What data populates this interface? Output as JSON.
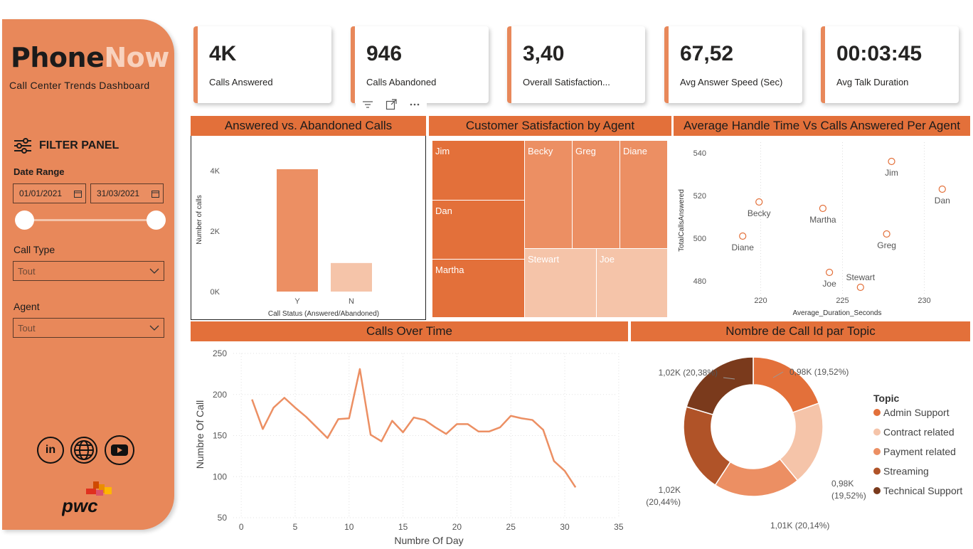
{
  "sidebar": {
    "brand_part1": "Phone",
    "brand_part2": "Now",
    "subtitle": "Call Center Trends Dashboard",
    "filter_title": "FILTER PANEL",
    "date_range_label": "Date Range",
    "date_start": "01/01/2021",
    "date_end": "31/03/2021",
    "call_type_label": "Call Type",
    "call_type_value": "Tout",
    "agent_label": "Agent",
    "agent_value": "Tout",
    "social_linkedin": "in",
    "pwc_text": "pwc"
  },
  "kpis": [
    {
      "value": "4K",
      "caption": "Calls Answered"
    },
    {
      "value": "946",
      "caption": "Calls Abandoned"
    },
    {
      "value": "3,40",
      "caption": "Overall Satisfaction..."
    },
    {
      "value": "67,52",
      "caption": "Avg Answer Speed (Sec)"
    },
    {
      "value": "00:03:45",
      "caption": "Avg Talk Duration"
    }
  ],
  "colors": {
    "accent": "#E3703A",
    "sidebar": "#E8885A",
    "bar_y": "#EC8F63",
    "bar_n": "#F5C4A9",
    "line": "#EC8F63",
    "treemap_dark": "#E3703A",
    "treemap_mid": "#EC8F63",
    "treemap_light": "#F5C4A9"
  },
  "charts": {
    "bar": {
      "title": "Answered vs. Abandoned Calls",
      "xlabel": "Call Status (Answered/Abandoned)",
      "ylabel": "Number of calls"
    },
    "treemap": {
      "title": "Customer Satisfaction by Agent"
    },
    "scatter": {
      "title": "Average Handle Time Vs Calls Answered Per Agent",
      "xlabel": "Average_Duration_Seconds",
      "ylabel": "TotalCallsAnswered"
    },
    "line": {
      "title": "Calls Over Time",
      "xlabel": "Numbre Of Day",
      "ylabel": "Numbre Of Call"
    },
    "donut": {
      "title": "Nombre de Call Id par Topic",
      "legend_title": "Topic"
    }
  },
  "chart_data": [
    {
      "type": "bar",
      "categories": [
        "Y",
        "N"
      ],
      "values": [
        4054,
        946
      ],
      "ylim": [
        0,
        4500
      ],
      "yticks": [
        "0K",
        "2K",
        "4K"
      ],
      "ytick_values": [
        0,
        2000,
        4000
      ]
    },
    {
      "type": "treemap",
      "items": [
        {
          "name": "Jim",
          "shade": "dark"
        },
        {
          "name": "Dan",
          "shade": "dark"
        },
        {
          "name": "Martha",
          "shade": "dark"
        },
        {
          "name": "Becky",
          "shade": "mid"
        },
        {
          "name": "Greg",
          "shade": "mid"
        },
        {
          "name": "Diane",
          "shade": "mid"
        },
        {
          "name": "Stewart",
          "shade": "light"
        },
        {
          "name": "Joe",
          "shade": "light"
        }
      ]
    },
    {
      "type": "scatter",
      "xlim": [
        217.5,
        232.5
      ],
      "ylim": [
        470,
        545
      ],
      "xticks": [
        220,
        225,
        230
      ],
      "yticks": [
        480,
        500,
        520,
        540
      ],
      "points": [
        {
          "label": "Jim",
          "x": 228.0,
          "y": 536
        },
        {
          "label": "Dan",
          "x": 231.1,
          "y": 523
        },
        {
          "label": "Becky",
          "x": 219.9,
          "y": 517
        },
        {
          "label": "Martha",
          "x": 223.8,
          "y": 514
        },
        {
          "label": "Greg",
          "x": 227.7,
          "y": 502
        },
        {
          "label": "Diane",
          "x": 218.9,
          "y": 501
        },
        {
          "label": "Stewart",
          "x": 226.1,
          "y": 477
        },
        {
          "label": "Joe",
          "x": 224.2,
          "y": 484
        }
      ]
    },
    {
      "type": "line",
      "xlim": [
        -1,
        36
      ],
      "ylim": [
        50,
        250
      ],
      "xticks": [
        0,
        5,
        10,
        15,
        20,
        25,
        30,
        35
      ],
      "yticks": [
        50,
        100,
        150,
        200,
        250
      ],
      "x": [
        1,
        2,
        3,
        4,
        5,
        6,
        7,
        8,
        9,
        10,
        11,
        12,
        13,
        14,
        15,
        16,
        17,
        18,
        19,
        20,
        21,
        22,
        23,
        24,
        25,
        26,
        27,
        28,
        29,
        30,
        31
      ],
      "y": [
        194,
        158,
        184,
        196,
        184,
        173,
        160,
        147,
        170,
        171,
        231,
        151,
        143,
        168,
        154,
        172,
        169,
        160,
        152,
        164,
        164,
        155,
        155,
        160,
        174,
        171,
        169,
        157,
        119,
        107,
        87
      ]
    },
    {
      "type": "pie",
      "donut": true,
      "slices": [
        {
          "name": "Admin Support",
          "label": "0,98K (19,52%)",
          "value": 19.52,
          "color": "#E3703A"
        },
        {
          "name": "Contract related",
          "label_line1": "0,98K",
          "label_line2": "(19,52%)",
          "value": 19.52,
          "color": "#F5C4A9"
        },
        {
          "name": "Payment related",
          "label": "1,01K (20,14%)",
          "value": 20.14,
          "color": "#EC8F63"
        },
        {
          "name": "Streaming",
          "label_line1": "1,02K",
          "label_line2": "(20,44%)",
          "value": 20.44,
          "color": "#B05328"
        },
        {
          "name": "Technical Support",
          "label": "1,02K (20,38%)",
          "value": 20.38,
          "color": "#7A3A1C"
        }
      ]
    }
  ]
}
